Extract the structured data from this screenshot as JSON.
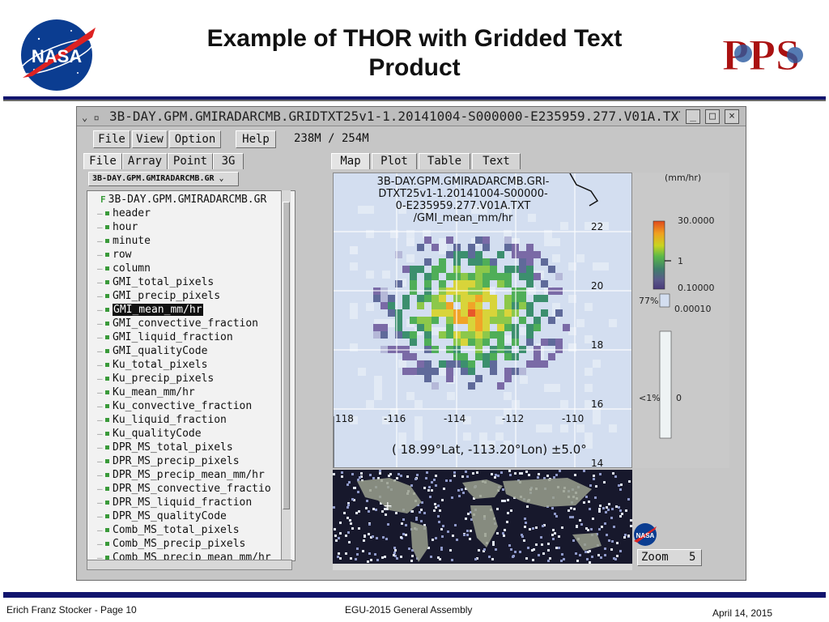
{
  "slide": {
    "title": "Example of THOR with Gridded Text Product",
    "footer_left": "Erich Franz Stocker - Page 10",
    "footer_center": "EGU-2015 General Assembly",
    "footer_right": "April 14, 2015"
  },
  "logos": {
    "left": "NASA",
    "right": "PPS"
  },
  "window": {
    "title": "3B-DAY.GPM.GMIRADARCMB.GRIDTXT25v1-1.20141004-S000000-E235959.277.V01A.TXT",
    "menu": [
      "File",
      "View",
      "Option",
      "Help"
    ],
    "memory": "238M / 254M",
    "left_tabs": [
      "File",
      "Array",
      "Point",
      "3G"
    ],
    "right_tabs": [
      "Map",
      "Plot",
      "Table",
      "Text"
    ],
    "file_dropdown": "3B-DAY.GPM.GMIRADARCMB.GR",
    "tree": {
      "root": "3B-DAY.GPM.GMIRADARCMB.GR",
      "selected_index": 8,
      "items": [
        "header",
        "hour",
        "minute",
        "row",
        "column",
        "GMI_total_pixels",
        "GMI_precip_pixels",
        "GMI_mean_mm/hr",
        "GMI_convective_fraction",
        "GMI_liquid_fraction",
        "GMI_qualityCode",
        "Ku_total_pixels",
        "Ku_precip_pixels",
        "Ku_mean_mm/hr",
        "Ku_convective_fraction",
        "Ku_liquid_fraction",
        "Ku_qualityCode",
        "DPR_MS_total_pixels",
        "DPR_MS_precip_pixels",
        "DPR_MS_precip_mean_mm/hr",
        "DPR_MS_convective_fractio",
        "DPR_MS_liquid_fraction",
        "DPR_MS_qualityCode",
        "Comb_MS_total_pixels",
        "Comb_MS_precip_pixels",
        "Comb_MS_precip_mean_mm/hr"
      ]
    },
    "map": {
      "overlay_lines": [
        "3B-DAY.GPM.GMIRADARCMB.GRI-",
        "DTXT25v1-1.20141004-S00000-",
        "0-E235959.277.V01A.TXT",
        "/GMI_mean_mm/hr"
      ],
      "lat_labels": [
        "22",
        "20",
        "18",
        "16",
        "14"
      ],
      "lon_labels": [
        "118",
        "-116",
        "-114",
        "-112",
        "-110"
      ],
      "center_readout": "( 18.99°Lat, -113.20°Lon) ±5.0°"
    },
    "legend": {
      "unit": "(mm/hr)",
      "ticks": [
        "30.0000",
        "1",
        "0.10000",
        "0.00010",
        "0"
      ],
      "pct_high": "77%",
      "pct_low": "<1%"
    },
    "zoom": {
      "label": "Zoom",
      "value": "5"
    }
  }
}
